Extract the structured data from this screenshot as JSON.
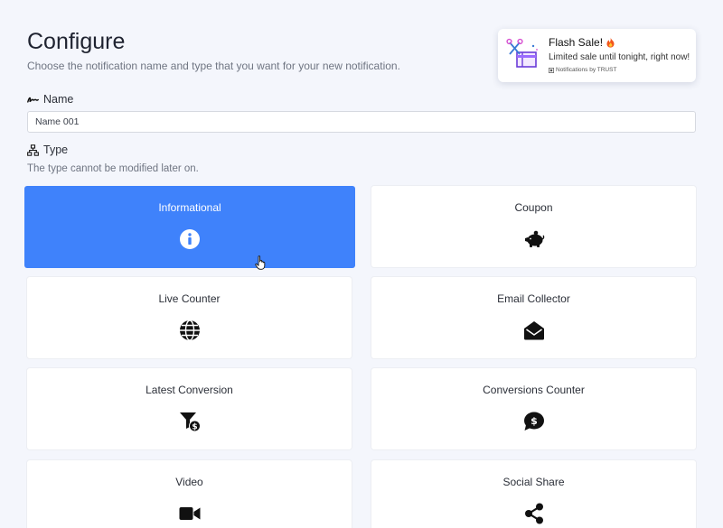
{
  "page": {
    "title": "Configure",
    "subtitle": "Choose the notification name and type that you want for your new notification."
  },
  "name_field": {
    "label": "Name",
    "value": "Name 001"
  },
  "type_field": {
    "label": "Type",
    "hint": "The type cannot be modified later on."
  },
  "types": [
    {
      "label": "Informational",
      "icon": "info-circle-icon",
      "selected": true
    },
    {
      "label": "Coupon",
      "icon": "piggy-bank-icon",
      "selected": false
    },
    {
      "label": "Live Counter",
      "icon": "globe-icon",
      "selected": false
    },
    {
      "label": "Email Collector",
      "icon": "envelope-open-icon",
      "selected": false
    },
    {
      "label": "Latest Conversion",
      "icon": "funnel-dollar-icon",
      "selected": false
    },
    {
      "label": "Conversions Counter",
      "icon": "comment-dollar-icon",
      "selected": false
    },
    {
      "label": "Video",
      "icon": "video-camera-icon",
      "selected": false
    },
    {
      "label": "Social Share",
      "icon": "share-icon",
      "selected": false
    }
  ],
  "toast": {
    "title": "Flash Sale!",
    "description": "Limited sale until tonight, right now!",
    "credit": "Notifications by TRUST"
  },
  "colors": {
    "accent": "#3f82fb",
    "background": "#f4f6fc"
  }
}
